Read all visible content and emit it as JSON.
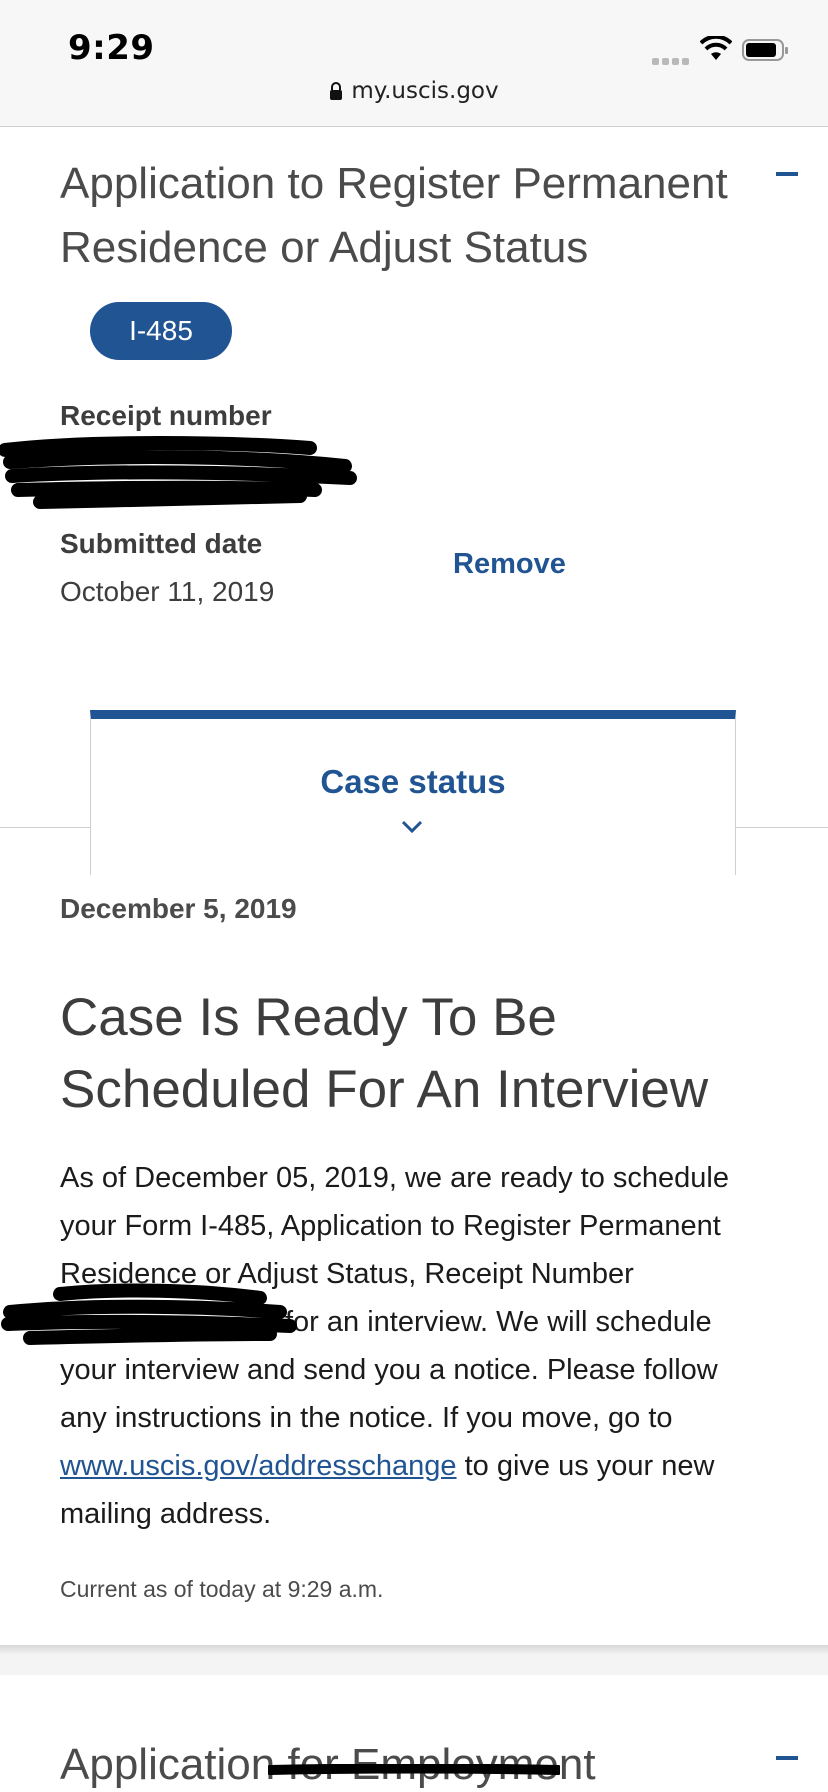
{
  "status_bar": {
    "time": "9:29"
  },
  "browser": {
    "url": "my.uscis.gov"
  },
  "case_card": {
    "title": "Application to Register Permanent Residence or Adjust Status",
    "form_badge": "I-485",
    "receipt_label": "Receipt number",
    "submitted_label": "Submitted date",
    "submitted_value": "October 11, 2019",
    "remove_label": "Remove"
  },
  "tab": {
    "label": "Case status"
  },
  "case_status": {
    "date": "December 5, 2019",
    "title": "Case Is Ready To Be Scheduled For An Interview",
    "body_part1": "As of December 05, 2019, we are ready to schedule your Form I-485, Application to Register Permanent Residence or Adjust Status, Receipt Number ",
    "body_part2": "for an interview. We will schedule your interview and send you a notice. Please follow any instructions in the notice. If you move, go to ",
    "link_text": "www.uscis.gov/addresschange",
    "body_part3": " to give us your new mailing address.",
    "current_as_of": "Current as of today at 9:29 a.m."
  },
  "next_card": {
    "title": "Application for Employment"
  },
  "colors": {
    "accent": "#205493",
    "text": "#3d3d3d"
  }
}
